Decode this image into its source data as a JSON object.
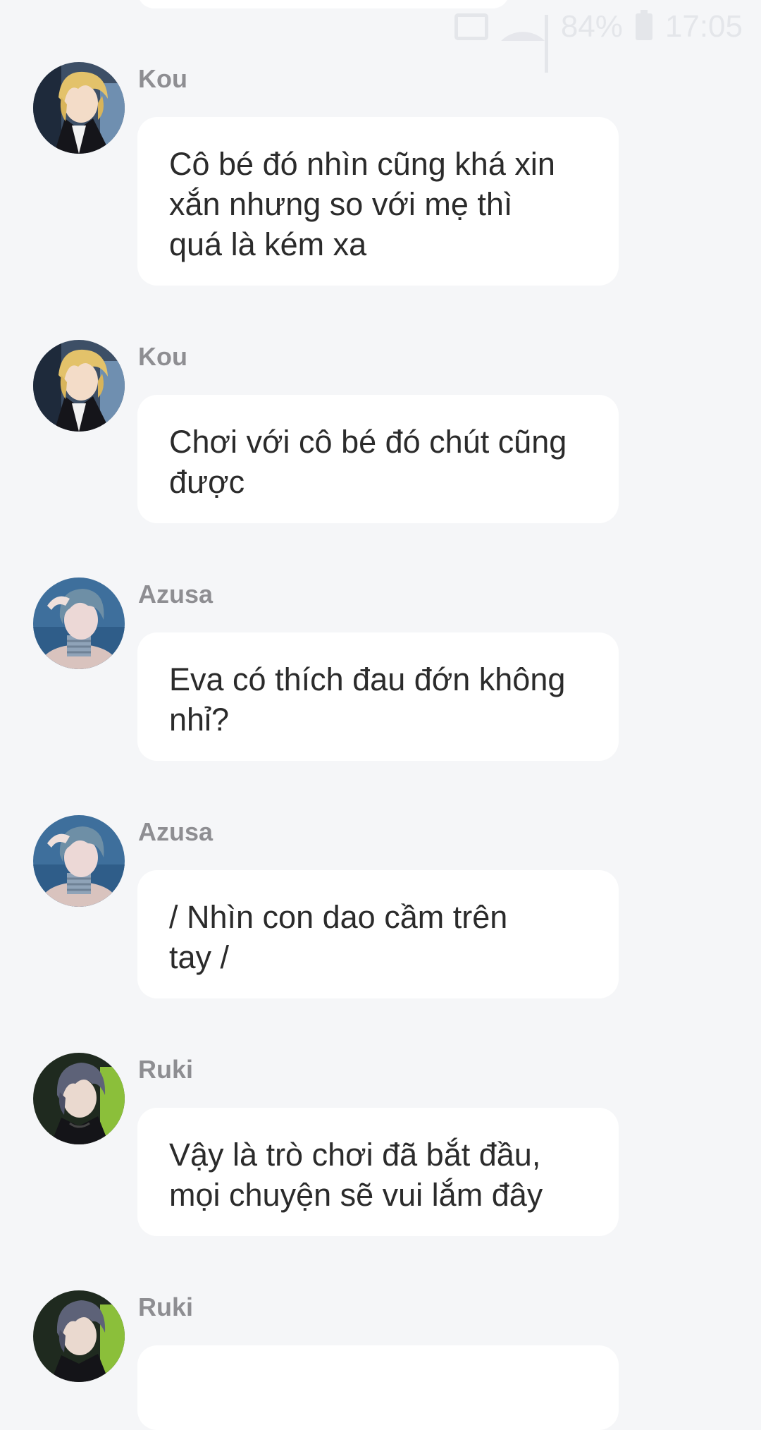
{
  "status_bar": {
    "battery": "84%",
    "time": "17:05",
    "icons": [
      "cast-icon",
      "wifi-icon",
      "signal-icon",
      "battery-icon"
    ]
  },
  "messages": [
    {
      "sender": "Kou",
      "text": "Cô bé đó nhìn cũng khá xin\nxắn nhưng so với mẹ thì\nquá là kém xa",
      "avatar": "kou-avatar"
    },
    {
      "sender": "Kou",
      "text": "Chơi với cô bé đó chút cũng\nđược",
      "avatar": "kou-avatar"
    },
    {
      "sender": "Azusa",
      "text": "Eva có thích đau đớn không\nnhỉ?",
      "avatar": "azusa-avatar"
    },
    {
      "sender": "Azusa",
      "text": "/ Nhìn con dao cầm trên\ntay /",
      "avatar": "azusa-avatar"
    },
    {
      "sender": "Ruki",
      "text": "Vậy là trò chơi đã bắt đầu,\nmọi chuyện sẽ vui lắm đây",
      "avatar": "ruki-avatar"
    },
    {
      "sender": "Ruki",
      "text": "",
      "avatar": "ruki-avatar"
    }
  ]
}
